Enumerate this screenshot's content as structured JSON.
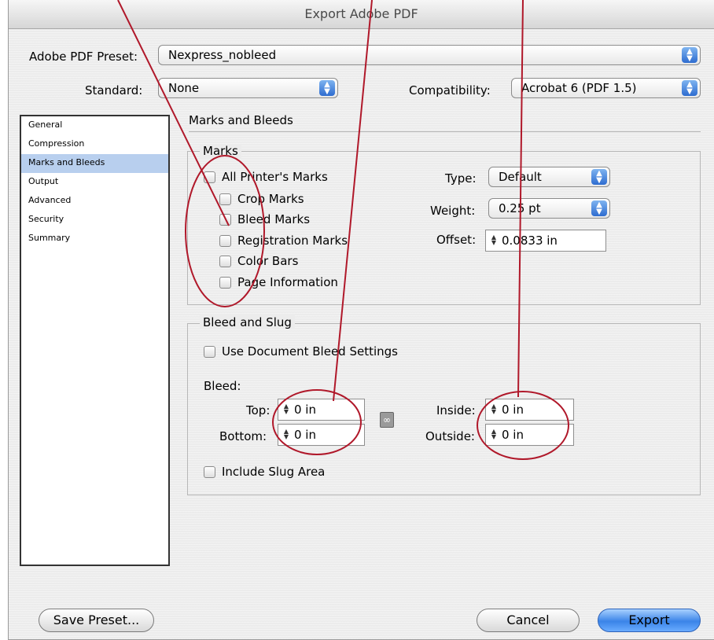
{
  "window": {
    "title": "Export Adobe PDF"
  },
  "preset": {
    "label": "Adobe PDF Preset:",
    "value": "Nexpress_nobleed"
  },
  "standard": {
    "label": "Standard:",
    "value": "None"
  },
  "compatibility": {
    "label": "Compatibility:",
    "value": "Acrobat 6 (PDF 1.5)"
  },
  "sidebar": {
    "items": [
      {
        "label": "General"
      },
      {
        "label": "Compression"
      },
      {
        "label": "Marks and Bleeds"
      },
      {
        "label": "Output"
      },
      {
        "label": "Advanced"
      },
      {
        "label": "Security"
      },
      {
        "label": "Summary"
      }
    ],
    "selected": "Marks and Bleeds"
  },
  "panel": {
    "title": "Marks and Bleeds"
  },
  "marks": {
    "legend": "Marks",
    "checkboxes": [
      {
        "label": "All Printer's Marks",
        "checked": false
      },
      {
        "label": "Crop Marks",
        "checked": false
      },
      {
        "label": "Bleed Marks",
        "checked": false
      },
      {
        "label": "Registration Marks",
        "checked": false
      },
      {
        "label": "Color Bars",
        "checked": false
      },
      {
        "label": "Page Information",
        "checked": false
      }
    ],
    "type": {
      "label": "Type:",
      "value": "Default"
    },
    "weight": {
      "label": "Weight:",
      "value": "0.25 pt"
    },
    "offset": {
      "label": "Offset:",
      "value": "0.0833 in"
    }
  },
  "bleed_slug": {
    "legend": "Bleed and Slug",
    "use_document_bleed": {
      "label": "Use Document Bleed Settings",
      "checked": false
    },
    "bleed_label": "Bleed:",
    "top": {
      "label": "Top:",
      "value": "0 in"
    },
    "bottom": {
      "label": "Bottom:",
      "value": "0 in"
    },
    "inside": {
      "label": "Inside:",
      "value": "0 in"
    },
    "outside": {
      "label": "Outside:",
      "value": "0 in"
    },
    "include_slug": {
      "label": "Include Slug Area",
      "checked": false
    }
  },
  "buttons": {
    "save_preset": "Save Preset...",
    "cancel": "Cancel",
    "export": "Export"
  },
  "colors": {
    "selection": "#b8cfee",
    "annotation": "#b0182a",
    "default_button": "#3a84e8"
  },
  "icons": {
    "popup_arrows": "up-down-arrows-icon",
    "stepper": "stepper-arrows-icon",
    "chain": "chain-link-icon"
  }
}
